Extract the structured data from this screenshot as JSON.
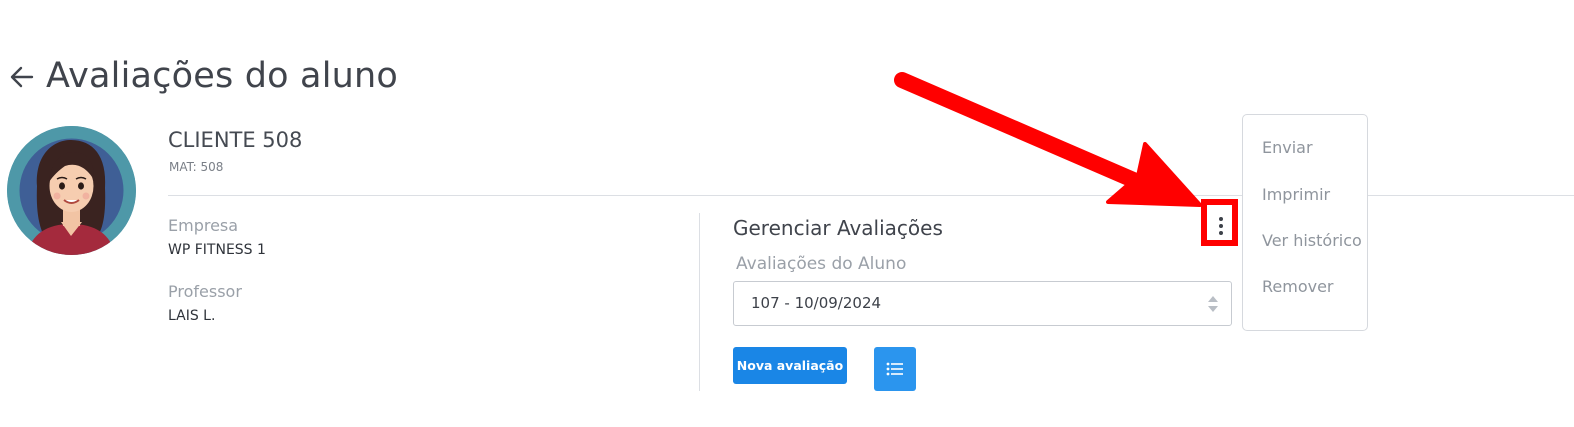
{
  "page": {
    "title": "Avaliações do aluno",
    "back_icon": "arrow-left-icon"
  },
  "client": {
    "name": "CLIENTE 508",
    "mat": "MAT: 508",
    "avatar_icon": "woman-avatar"
  },
  "info": {
    "empresa_label": "Empresa",
    "empresa_value": "WP FITNESS 1",
    "professor_label": "Professor",
    "professor_value": "LAIS L."
  },
  "manage": {
    "title": "Gerenciar Avaliações",
    "select_label": "Avaliações do Aluno",
    "select_value": "107 - 10/09/2024",
    "new_button": "Nova avaliação",
    "list_icon": "list-icon",
    "more_icon": "kebab-menu-icon"
  },
  "menu": {
    "items": [
      "Enviar",
      "Imprimir",
      "Ver histórico",
      "Remover"
    ]
  },
  "colors": {
    "primary": "#1a86e6",
    "annotation": "#ff0000",
    "avatar_bg": "#4e98a8"
  }
}
